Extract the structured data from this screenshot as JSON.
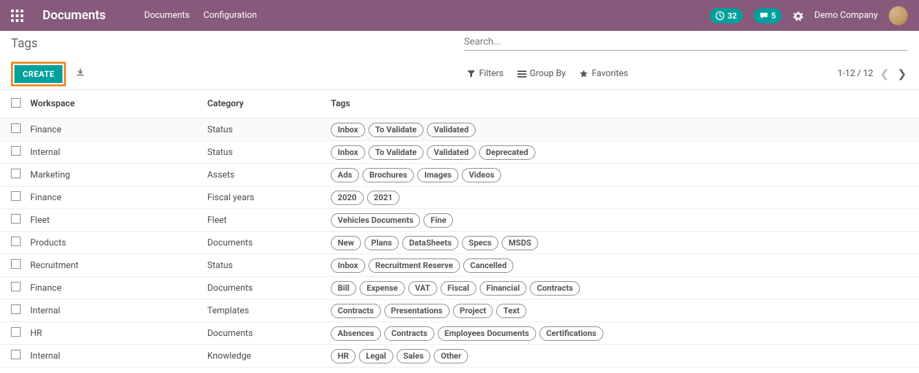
{
  "topnav": {
    "brand": "Documents",
    "links": [
      "Documents",
      "Configuration"
    ],
    "timer_count": "32",
    "chat_count": "5",
    "company": "Demo Company"
  },
  "cp": {
    "breadcrumb": "Tags",
    "search_placeholder": "Search...",
    "create_label": "CREATE",
    "filters_label": "Filters",
    "groupby_label": "Group By",
    "favorites_label": "Favorites",
    "page_range": "1-12 / 12"
  },
  "table": {
    "cols": {
      "workspace": "Workspace",
      "category": "Category",
      "tags": "Tags"
    },
    "rows": [
      {
        "workspace": "Finance",
        "category": "Status",
        "tags": [
          "Inbox",
          "To Validate",
          "Validated"
        ]
      },
      {
        "workspace": "Internal",
        "category": "Status",
        "tags": [
          "Inbox",
          "To Validate",
          "Validated",
          "Deprecated"
        ]
      },
      {
        "workspace": "Marketing",
        "category": "Assets",
        "tags": [
          "Ads",
          "Brochures",
          "Images",
          "Videos"
        ]
      },
      {
        "workspace": "Finance",
        "category": "Fiscal years",
        "tags": [
          "2020",
          "2021"
        ]
      },
      {
        "workspace": "Fleet",
        "category": "Fleet",
        "tags": [
          "Vehicles Documents",
          "Fine"
        ]
      },
      {
        "workspace": "Products",
        "category": "Documents",
        "tags": [
          "New",
          "Plans",
          "DataSheets",
          "Specs",
          "MSDS"
        ]
      },
      {
        "workspace": "Recruitment",
        "category": "Status",
        "tags": [
          "Inbox",
          "Recruitment Reserve",
          "Cancelled"
        ]
      },
      {
        "workspace": "Finance",
        "category": "Documents",
        "tags": [
          "Bill",
          "Expense",
          "VAT",
          "Fiscal",
          "Financial",
          "Contracts"
        ]
      },
      {
        "workspace": "Internal",
        "category": "Templates",
        "tags": [
          "Contracts",
          "Presentations",
          "Project",
          "Text"
        ]
      },
      {
        "workspace": "HR",
        "category": "Documents",
        "tags": [
          "Absences",
          "Contracts",
          "Employees Documents",
          "Certifications"
        ]
      },
      {
        "workspace": "Internal",
        "category": "Knowledge",
        "tags": [
          "HR",
          "Legal",
          "Sales",
          "Other"
        ]
      }
    ]
  }
}
